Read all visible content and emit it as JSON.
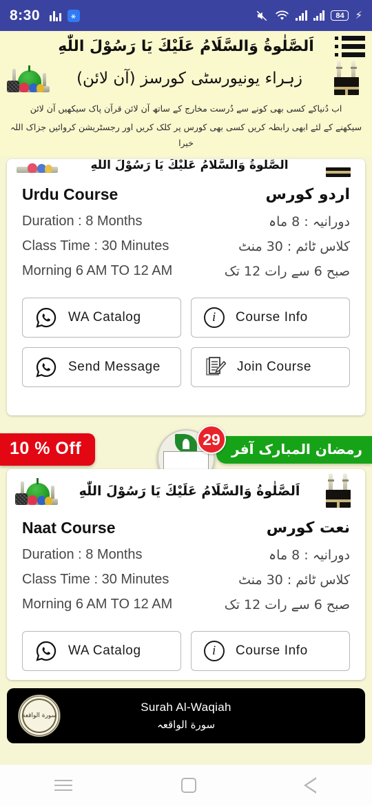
{
  "status_bar": {
    "time": "8:30",
    "battery_level": "84",
    "icons": [
      "equalizer-icon",
      "app-icon",
      "mute-icon",
      "wifi-icon",
      "signal-icon",
      "signal-icon-2",
      "battery-icon",
      "charging-bolt-icon"
    ]
  },
  "header": {
    "salam": "اَلصَّلٰوةُ وَالسَّلَامُ عَلَيْكَ يَا رَسُوْلَ اللّٰهِ",
    "title": "زہراء یونیورسٹی کورسز (آن لائن)",
    "description_line1": "اب دُنیاکے کسی بھی کونے سے دُرست مخارج کے ساتھ آن لائن قرآن پاک سیکھیں آن لائن",
    "description_line2": "سیکھنے کے لئے ابھی رابطہ کریں کسی بھی کورس پر کلک کریں اور رجسٹریشن کروائیں جزاک اللہ خیرا",
    "menu_label": "Menu"
  },
  "offer": {
    "discount_badge": "10 % Off",
    "ramadan_badge": "رمضان المبارک آفر",
    "notification_count": "29",
    "medal_label": "Result Card"
  },
  "courses": [
    {
      "banner_salam": "اَلصَّلٰوةُ وَالسَّلَامُ عَلَيْكَ يَا رَسُوْلَ اللّٰهِ",
      "title_en": "Urdu Course",
      "title_ur": "اردو کورس",
      "details": [
        {
          "en": "Duration : 8 Months",
          "ur": "دورانیہ : 8 ماہ"
        },
        {
          "en": "Class Time : 30 Minutes",
          "ur": "کلاس ٹائم : 30 منٹ"
        },
        {
          "en": "Morning 6 AM TO 12 AM",
          "ur": "صبح 6 سے رات 12 تک"
        }
      ],
      "buttons": [
        {
          "label": "WA Catalog",
          "icon": "whatsapp-icon"
        },
        {
          "label": "Course Info",
          "icon": "info-icon"
        },
        {
          "label": "Send Message",
          "icon": "whatsapp-icon"
        },
        {
          "label": "Join Course",
          "icon": "join-form-icon"
        }
      ]
    },
    {
      "banner_salam": "اَلصَّلٰوةُ وَالسَّلَامُ عَلَيْكَ يَا رَسُوْلَ اللّٰهِ",
      "title_en": "Naat Course",
      "title_ur": "نعت کورس",
      "details": [
        {
          "en": "Duration : 8 Months",
          "ur": "دورانیہ : 8 ماہ"
        },
        {
          "en": "Class Time : 30 Minutes",
          "ur": "کلاس ٹائم : 30 منٹ"
        },
        {
          "en": "Morning 6 AM TO 12 AM",
          "ur": "صبح 6 سے رات 12 تک"
        }
      ],
      "buttons": [
        {
          "label": "WA Catalog",
          "icon": "whatsapp-icon"
        },
        {
          "label": "Course Info",
          "icon": "info-icon"
        }
      ]
    }
  ],
  "surah_banner": {
    "title_en": "Surah Al-Waqiah",
    "title_ur": "سورة الواقعہ",
    "seal_text": "سورة الواقعة"
  },
  "nav_bar": {
    "recents": "Recents",
    "home": "Home",
    "back": "Back"
  },
  "colors": {
    "status_bar": "#3B43A0",
    "page_background": "#F6F5D4",
    "header_background": "#FAF8CD",
    "discount_red": "#E30613",
    "ramadan_green": "#17A318",
    "notification_red": "#E8232B",
    "surah_bar": "#000000"
  }
}
